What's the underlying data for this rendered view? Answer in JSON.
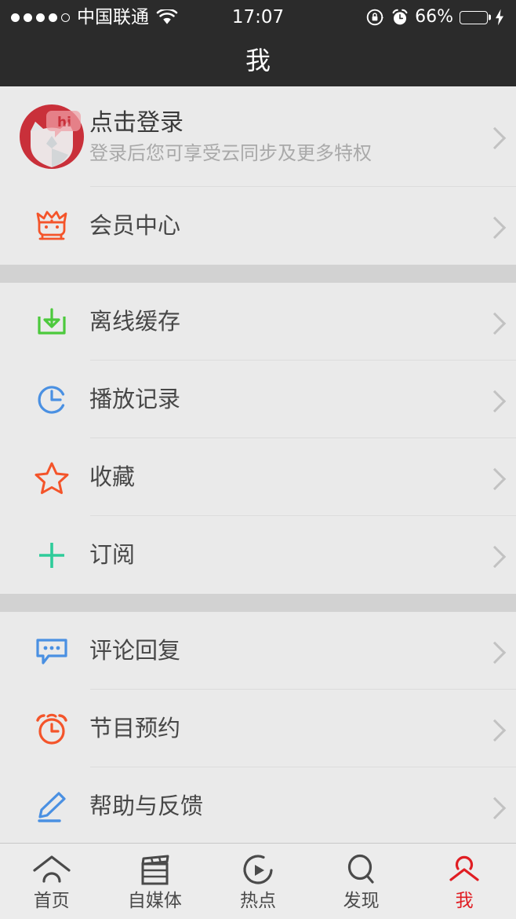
{
  "statusbar": {
    "signal_dots_filled": 4,
    "signal_dots_total": 5,
    "carrier": "中国联通",
    "wifi_icon": "wifi-icon",
    "time": "17:07",
    "rotation_lock_icon": "rotation-lock-icon",
    "alarm_icon": "alarm-icon",
    "battery_percent": "66%",
    "battery_level": 66,
    "charging_icon": "lightning-bolt-icon",
    "battery_color": "#4cd964",
    "background": "#2b2b2b"
  },
  "navbar": {
    "title": "我"
  },
  "profile": {
    "avatar_icon": "fox-avatar-icon",
    "avatar_badge_text": "hi",
    "avatar_color": "#c9303a",
    "title": "点击登录",
    "subtitle": "登录后您可享受云同步及更多特权",
    "chevron_icon": "chevron-right-icon"
  },
  "groups": [
    {
      "rows": [
        {
          "label": "会员中心",
          "icon": "crown-cat-icon",
          "icon_color": "#f4542a",
          "chevron_icon": "chevron-right-icon"
        }
      ]
    },
    {
      "rows": [
        {
          "label": "离线缓存",
          "icon": "download-icon",
          "icon_color": "#4cc93c",
          "chevron_icon": "chevron-right-icon"
        },
        {
          "label": "播放记录",
          "icon": "history-clock-icon",
          "icon_color": "#4a90e2",
          "chevron_icon": "chevron-right-icon"
        },
        {
          "label": "收藏",
          "icon": "star-icon",
          "icon_color": "#f4542a",
          "chevron_icon": "chevron-right-icon"
        },
        {
          "label": "订阅",
          "icon": "plus-icon",
          "icon_color": "#2ecc9a",
          "chevron_icon": "chevron-right-icon"
        }
      ]
    },
    {
      "rows": [
        {
          "label": "评论回复",
          "icon": "comment-bubble-icon",
          "icon_color": "#4a90e2",
          "chevron_icon": "chevron-right-icon"
        },
        {
          "label": "节目预约",
          "icon": "alarm-clock-icon",
          "icon_color": "#f4542a",
          "chevron_icon": "chevron-right-icon"
        },
        {
          "label": "帮助与反馈",
          "icon": "pencil-edit-icon",
          "icon_color": "#4a90e2",
          "chevron_icon": "chevron-right-icon"
        }
      ]
    }
  ],
  "tabbar": {
    "active_color": "#e01e23",
    "inactive_color": "#4a4a4a",
    "tabs": [
      {
        "label": "首页",
        "icon": "home-arch-icon",
        "active": false
      },
      {
        "label": "自媒体",
        "icon": "clapperboard-icon",
        "active": false
      },
      {
        "label": "热点",
        "icon": "play-circle-icon",
        "active": false
      },
      {
        "label": "发现",
        "icon": "search-magnifier-icon",
        "active": false
      },
      {
        "label": "我",
        "icon": "person-icon",
        "active": true
      }
    ]
  }
}
